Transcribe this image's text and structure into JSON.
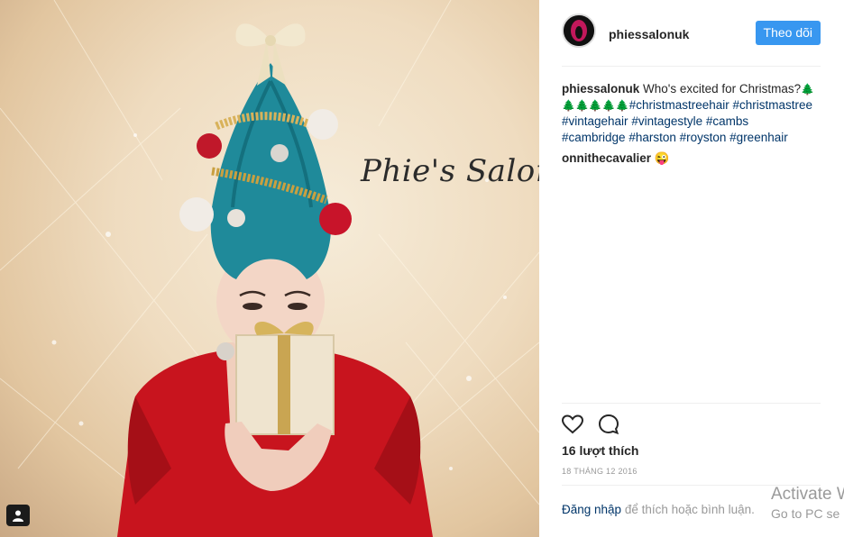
{
  "photo": {
    "overlay_text": "Phie's Salon"
  },
  "header": {
    "username": "phiessalonuk",
    "follow_label": "Theo dõi"
  },
  "caption": {
    "username": "phiessalonuk",
    "text": "Who's excited for Christmas?",
    "tree_emoji": "🌲",
    "tree_emoji_row": "🌲🌲🌲🌲🌲",
    "hashtags": [
      "#christmastreehair",
      "#christmastree",
      "#vintagehair",
      "#vintagestyle",
      "#cambs",
      "#cambridge",
      "#harston",
      "#royston",
      "#greenhair"
    ]
  },
  "comment": {
    "username": "onnithecavalier",
    "emoji": "😜"
  },
  "likes": "16 lượt thích",
  "date": "18 THÁNG 12 2016",
  "login": {
    "link": "Đăng nhập",
    "rest": " để thích hoặc bình luận."
  },
  "watermark": {
    "line1": "Activate W",
    "line2": "Go to PC se"
  },
  "icons": [
    "heart-icon",
    "comment-icon",
    "user-tag-icon"
  ],
  "colors": {
    "follow_button": "#3897f0",
    "hashtag": "#003569"
  }
}
